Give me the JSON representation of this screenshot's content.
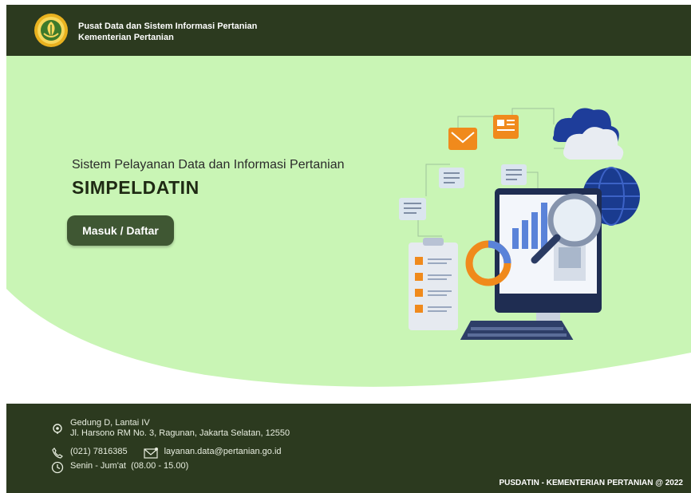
{
  "header": {
    "org_line1": "Pusat Data dan Sistem Informasi Pertanian",
    "org_line2": "Kementerian Pertanian",
    "logo_icon": "kementan-logo"
  },
  "hero": {
    "tagline": "Sistem Pelayanan Data dan Informasi Pertanian",
    "app_name": "SIMPELDATIN",
    "login_label": "Masuk / Daftar",
    "illustration": "data-analytics-illustration"
  },
  "footer": {
    "address_line1": "Gedung D, Lantai IV",
    "address_line2": "Jl. Harsono RM No. 3, Ragunan, Jakarta Selatan, 12550",
    "phone": "(021) 7816385",
    "email": "layanan.data@pertanian.go.id",
    "hours": "Senin - Jum'at  (08.00 - 15.00)",
    "copyright": "PUSDATIN - KEMENTERIAN PERTANIAN @ 2022"
  },
  "colors": {
    "header_bg": "#2c3a1f",
    "hero_green": "#c9f5b5",
    "button_bg": "#3f5733"
  }
}
